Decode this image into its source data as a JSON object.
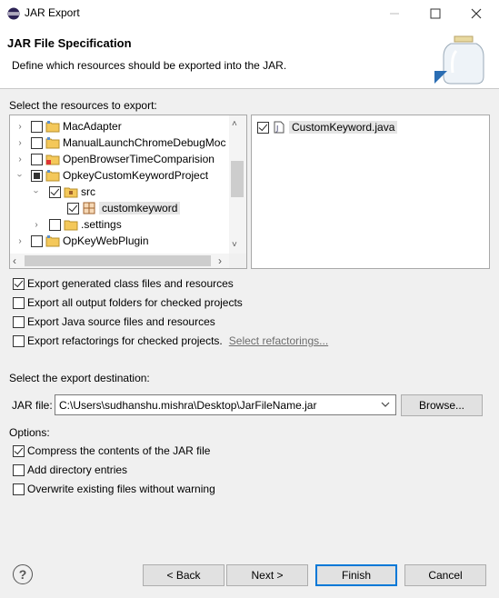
{
  "window": {
    "title": "JAR Export",
    "minimize_icon": "minimize-icon",
    "maximize_icon": "maximize-icon",
    "close_icon": "close-icon"
  },
  "header": {
    "title": "JAR File Specification",
    "description": "Define which resources should be exported into the JAR."
  },
  "resources": {
    "label": "Select the resources to export:",
    "tree": [
      {
        "label": "MacAdapter",
        "state": "unchecked",
        "expanded": false
      },
      {
        "label": "ManualLaunchChromeDebugMoc",
        "state": "unchecked",
        "expanded": false
      },
      {
        "label": "OpenBrowserTimeComparision",
        "state": "unchecked",
        "expanded": false
      },
      {
        "label": "OpkeyCustomKeywordProject",
        "state": "partial",
        "expanded": true
      },
      {
        "label": "src",
        "state": "checked",
        "expanded": true
      },
      {
        "label": "customkeyword",
        "state": "checked",
        "selected": true
      },
      {
        "label": ".settings",
        "state": "unchecked",
        "expanded": false
      },
      {
        "label": "OpKeyWebPlugin",
        "state": "unchecked",
        "expanded": false
      }
    ],
    "files": [
      {
        "label": "CustomKeyword.java",
        "state": "checked"
      }
    ]
  },
  "options_export": [
    {
      "label": "Export generated class files and resources",
      "checked": true
    },
    {
      "label": "Export all output folders for checked projects",
      "checked": false
    },
    {
      "label": "Export Java source files and resources",
      "checked": false
    },
    {
      "label": "Export refactorings for checked projects.",
      "checked": false,
      "link": "Select refactorings..."
    }
  ],
  "destination": {
    "label": "Select the export destination:",
    "jar_label": "JAR file:",
    "jar_value": "C:\\Users\\sudhanshu.mishra\\Desktop\\JarFileName.jar",
    "browse": "Browse..."
  },
  "options": {
    "label": "Options:",
    "items": [
      {
        "label": "Compress the contents of the JAR file",
        "checked": true
      },
      {
        "label": "Add directory entries",
        "checked": false
      },
      {
        "label": "Overwrite existing files without warning",
        "checked": false
      }
    ]
  },
  "footer": {
    "help": "?",
    "back": "< Back",
    "next": "Next >",
    "finish": "Finish",
    "cancel": "Cancel"
  }
}
